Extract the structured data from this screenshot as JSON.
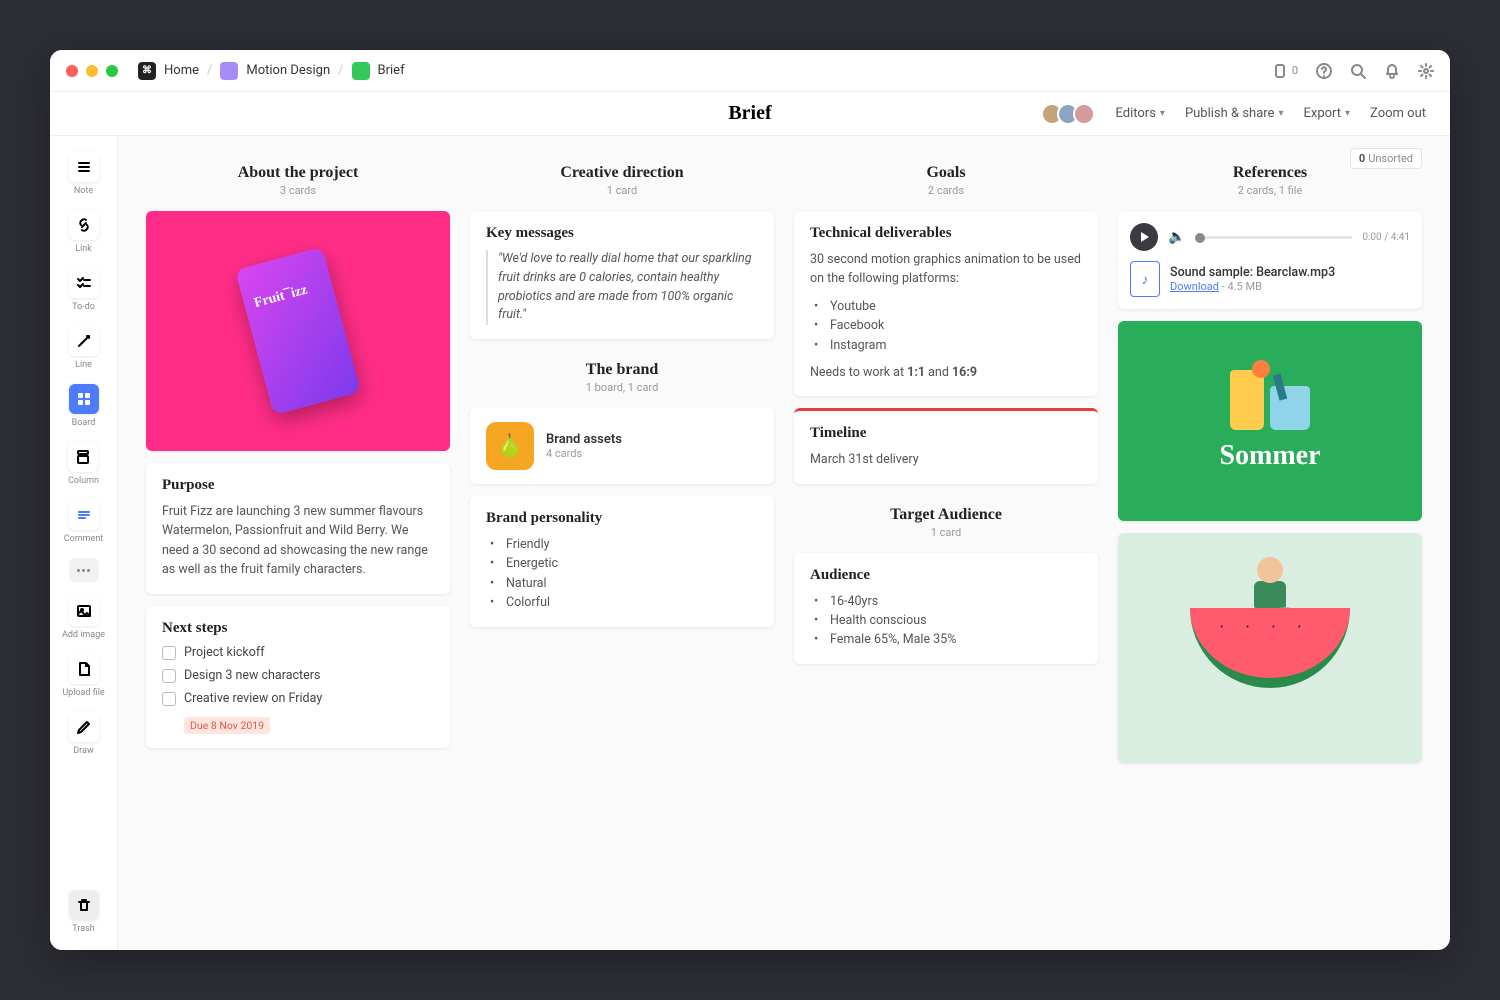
{
  "breadcrumb": {
    "home": "Home",
    "project": "Motion Design",
    "board": "Brief"
  },
  "titlebar_badge": "0",
  "page_title": "Brief",
  "header": {
    "editors": "Editors",
    "publish": "Publish & share",
    "export": "Export",
    "zoom": "Zoom out"
  },
  "unsorted": {
    "count": "0",
    "label": "Unsorted"
  },
  "sidebar": {
    "note": "Note",
    "link": "Link",
    "todo": "To-do",
    "line": "Line",
    "board": "Board",
    "column": "Column",
    "comment": "Comment",
    "addimage": "Add image",
    "upload": "Upload file",
    "draw": "Draw",
    "trash": "Trash"
  },
  "col1": {
    "title": "About the project",
    "sub": "3 cards",
    "purpose_h": "Purpose",
    "purpose_t": "Fruit Fizz are launching 3 new summer flavours Watermelon, Passionfruit and Wild Berry. We need a 30 second ad showcasing the new range as well as the fruit family characters.",
    "next_h": "Next steps",
    "todos": [
      "Project kickoff",
      "Design 3 new characters",
      "Creative review on Friday"
    ],
    "due": "Due 8 Nov 2019"
  },
  "col2": {
    "title": "Creative direction",
    "sub": "1 card",
    "key_h": "Key messages",
    "quote": "\"We'd love to really dial home that our sparkling fruit drinks are 0 calories, contain healthy probiotics and are made from 100% organic fruit.\"",
    "brand_t": "The brand",
    "brand_sub": "1 board, 1 card",
    "assets_t": "Brand assets",
    "assets_c": "4 cards",
    "pers_h": "Brand personality",
    "pers": [
      "Friendly",
      "Energetic",
      "Natural",
      "Colorful"
    ]
  },
  "col3": {
    "title": "Goals",
    "sub": "2 cards",
    "tech_h": "Technical deliverables",
    "tech_intro": "30 second motion graphics animation to be used on the following platforms:",
    "tech_list": [
      "Youtube",
      "Facebook",
      "Instagram"
    ],
    "tech_foot_a": "Needs to work at ",
    "tech_foot_b": "1:1",
    "tech_foot_c": " and ",
    "tech_foot_d": "16:9",
    "timeline_h": "Timeline",
    "timeline_t": "March 31st delivery",
    "aud_title": "Target Audience",
    "aud_sub": "1 card",
    "aud_h": "Audience",
    "aud_list": [
      "16-40yrs",
      "Health conscious",
      "Female 65%, Male 35%"
    ]
  },
  "col4": {
    "title": "References",
    "sub": "2 cards, 1 file",
    "time": "0:00 / 4:41",
    "filename": "Sound sample: Bearclaw.mp3",
    "download": "Download",
    "size": " - 4.5 MB",
    "sommer": "Sommer"
  }
}
